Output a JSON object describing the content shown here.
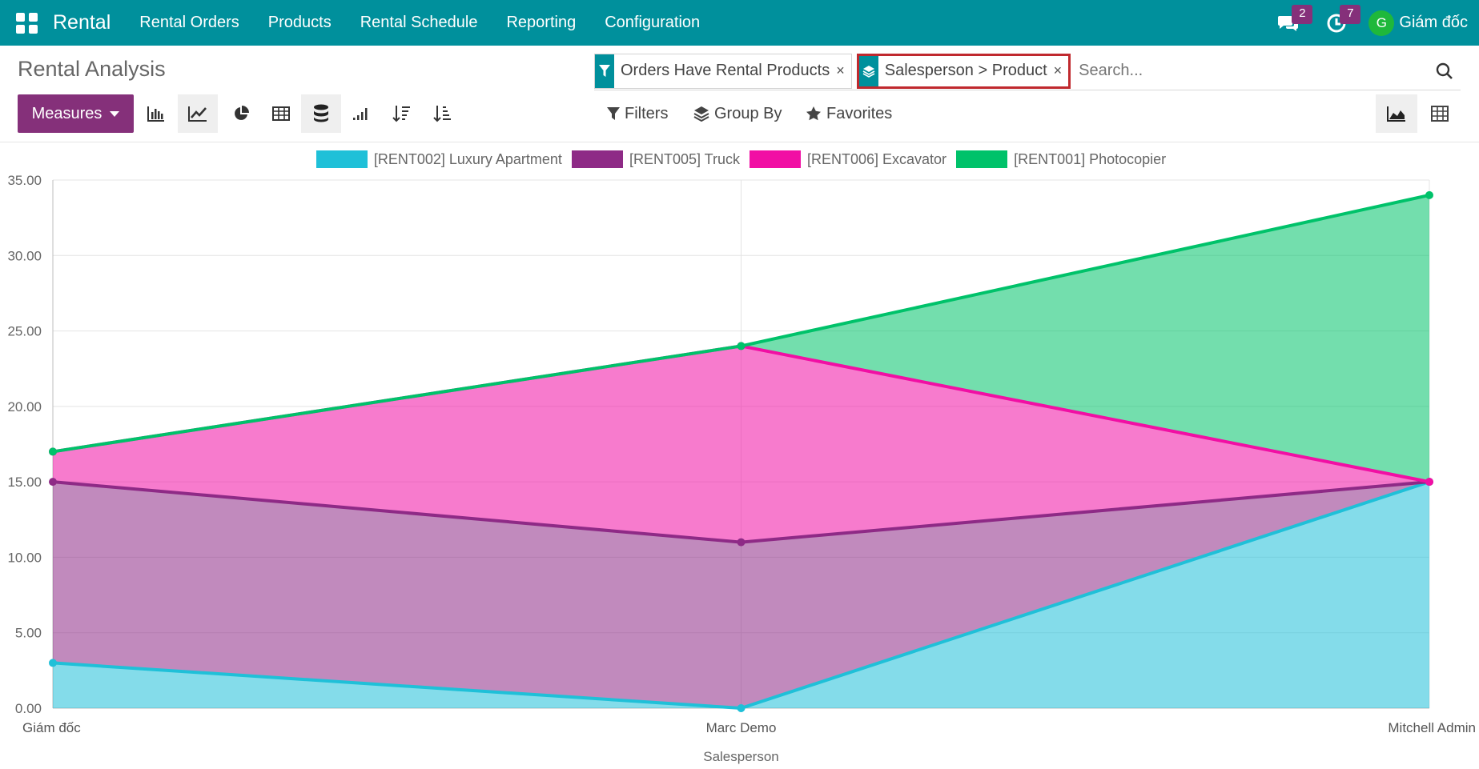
{
  "app": {
    "name": "Rental",
    "menu": [
      "Rental Orders",
      "Products",
      "Rental Schedule",
      "Reporting",
      "Configuration"
    ],
    "messages_count": "2",
    "activities_count": "7",
    "user_initial": "G",
    "user_name": "Giám đốc"
  },
  "page": {
    "title": "Rental Analysis",
    "facets": [
      {
        "icon": "filter-icon",
        "label": "Orders Have Rental Products"
      },
      {
        "icon": "layers-icon",
        "label": "Salesperson > Product"
      }
    ],
    "search_placeholder": "Search...",
    "measures_label": "Measures",
    "filters_label": "Filters",
    "groupby_label": "Group By",
    "favorites_label": "Favorites"
  },
  "colors": {
    "brand": "#00909c",
    "primary": "#85307a",
    "highlight": "#c0292e"
  },
  "chart_data": {
    "type": "area",
    "stacked": true,
    "xlabel": "Salesperson",
    "categories": [
      "Giám đốc",
      "Marc Demo",
      "Mitchell Admin"
    ],
    "ylim": [
      0,
      35
    ],
    "yticks": [
      "0.00",
      "5.00",
      "10.00",
      "15.00",
      "20.00",
      "25.00",
      "30.00",
      "35.00"
    ],
    "grid": true,
    "legend_position": "top",
    "series": [
      {
        "name": "[RENT002] Luxury Apartment",
        "color": "#1fc0d8",
        "values": [
          3,
          0,
          15
        ]
      },
      {
        "name": "[RENT005] Truck",
        "color": "#8e2a86",
        "values": [
          12,
          11,
          0
        ]
      },
      {
        "name": "[RENT006] Excavator",
        "color": "#f10fa4",
        "values": [
          2,
          13,
          0
        ]
      },
      {
        "name": "[RENT001] Photocopier",
        "color": "#00c26a",
        "values": [
          0,
          0,
          19
        ]
      }
    ]
  }
}
